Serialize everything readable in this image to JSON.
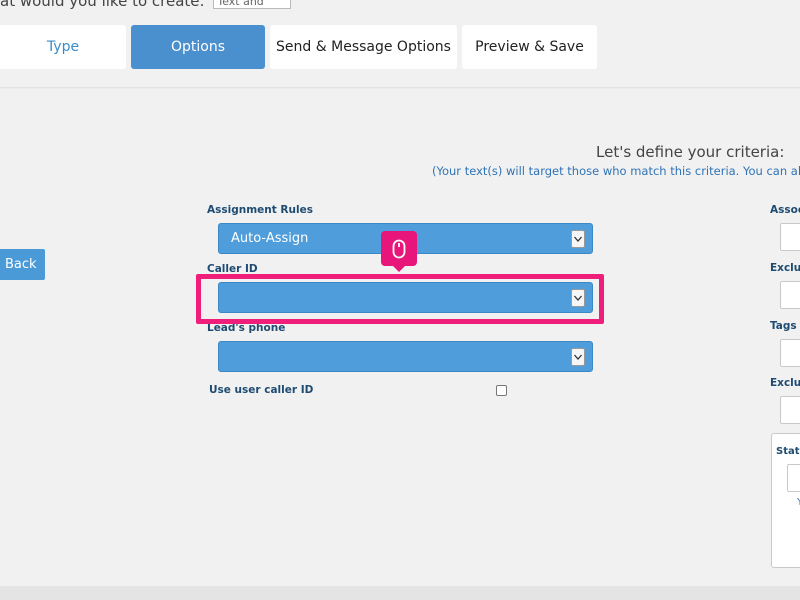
{
  "header": {
    "cutoff_text": "at would you like to create:",
    "cutoff_value": "Text and"
  },
  "tabs": [
    {
      "label": "Type"
    },
    {
      "label": "Options"
    },
    {
      "label": "Send & Message Options"
    },
    {
      "label": "Preview & Save"
    }
  ],
  "active_tab": "Options",
  "criteria": {
    "heading": "Let's define your criteria:",
    "subheading": "(Your text(s) will target those who match this criteria. You can also"
  },
  "back_label": "Back",
  "form": {
    "assignment_rules_label": "Assignment Rules",
    "assignment_rules_value": "Auto-Assign",
    "caller_id_label": "Caller ID",
    "caller_id_value": "",
    "leads_phone_label": "Lead's phone",
    "leads_phone_value": "",
    "use_user_caller_id_label": "Use user caller ID",
    "use_user_caller_id_checked": false
  },
  "right_column": {
    "labels": [
      "Assoc",
      "Exclu",
      "Tags",
      "Exclu"
    ],
    "status_label": "Statu",
    "status_mark": "Y"
  },
  "colors": {
    "accent": "#4a8fce",
    "select_bg": "#4f9edb",
    "highlight": "#ee1e7a",
    "label": "#1e4b72",
    "link": "#2f73b5"
  },
  "icons": {
    "dropdown": "chevron-down-icon",
    "cursor": "mouse-icon"
  }
}
